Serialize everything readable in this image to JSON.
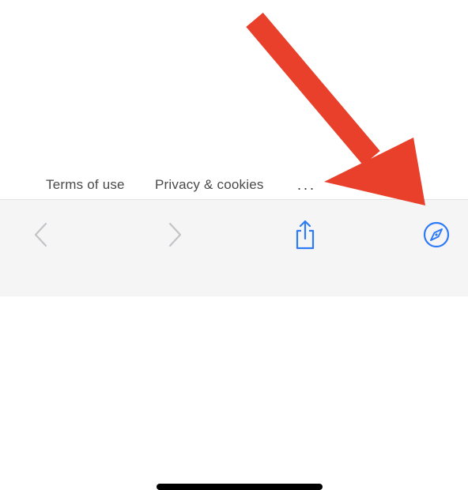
{
  "footer": {
    "terms_label": "Terms of use",
    "privacy_label": "Privacy & cookies",
    "more_label": "..."
  },
  "toolbar": {
    "back_icon": "chevron-left-icon",
    "forward_icon": "chevron-right-icon",
    "share_icon": "share-icon",
    "safari_icon": "compass-icon"
  },
  "colors": {
    "accent": "#2f7bf5",
    "disabled": "#c3c3c8",
    "toolbar_bg": "#f5f5f6",
    "annotation": "#e8402a",
    "link_text": "#4a4a4a"
  }
}
